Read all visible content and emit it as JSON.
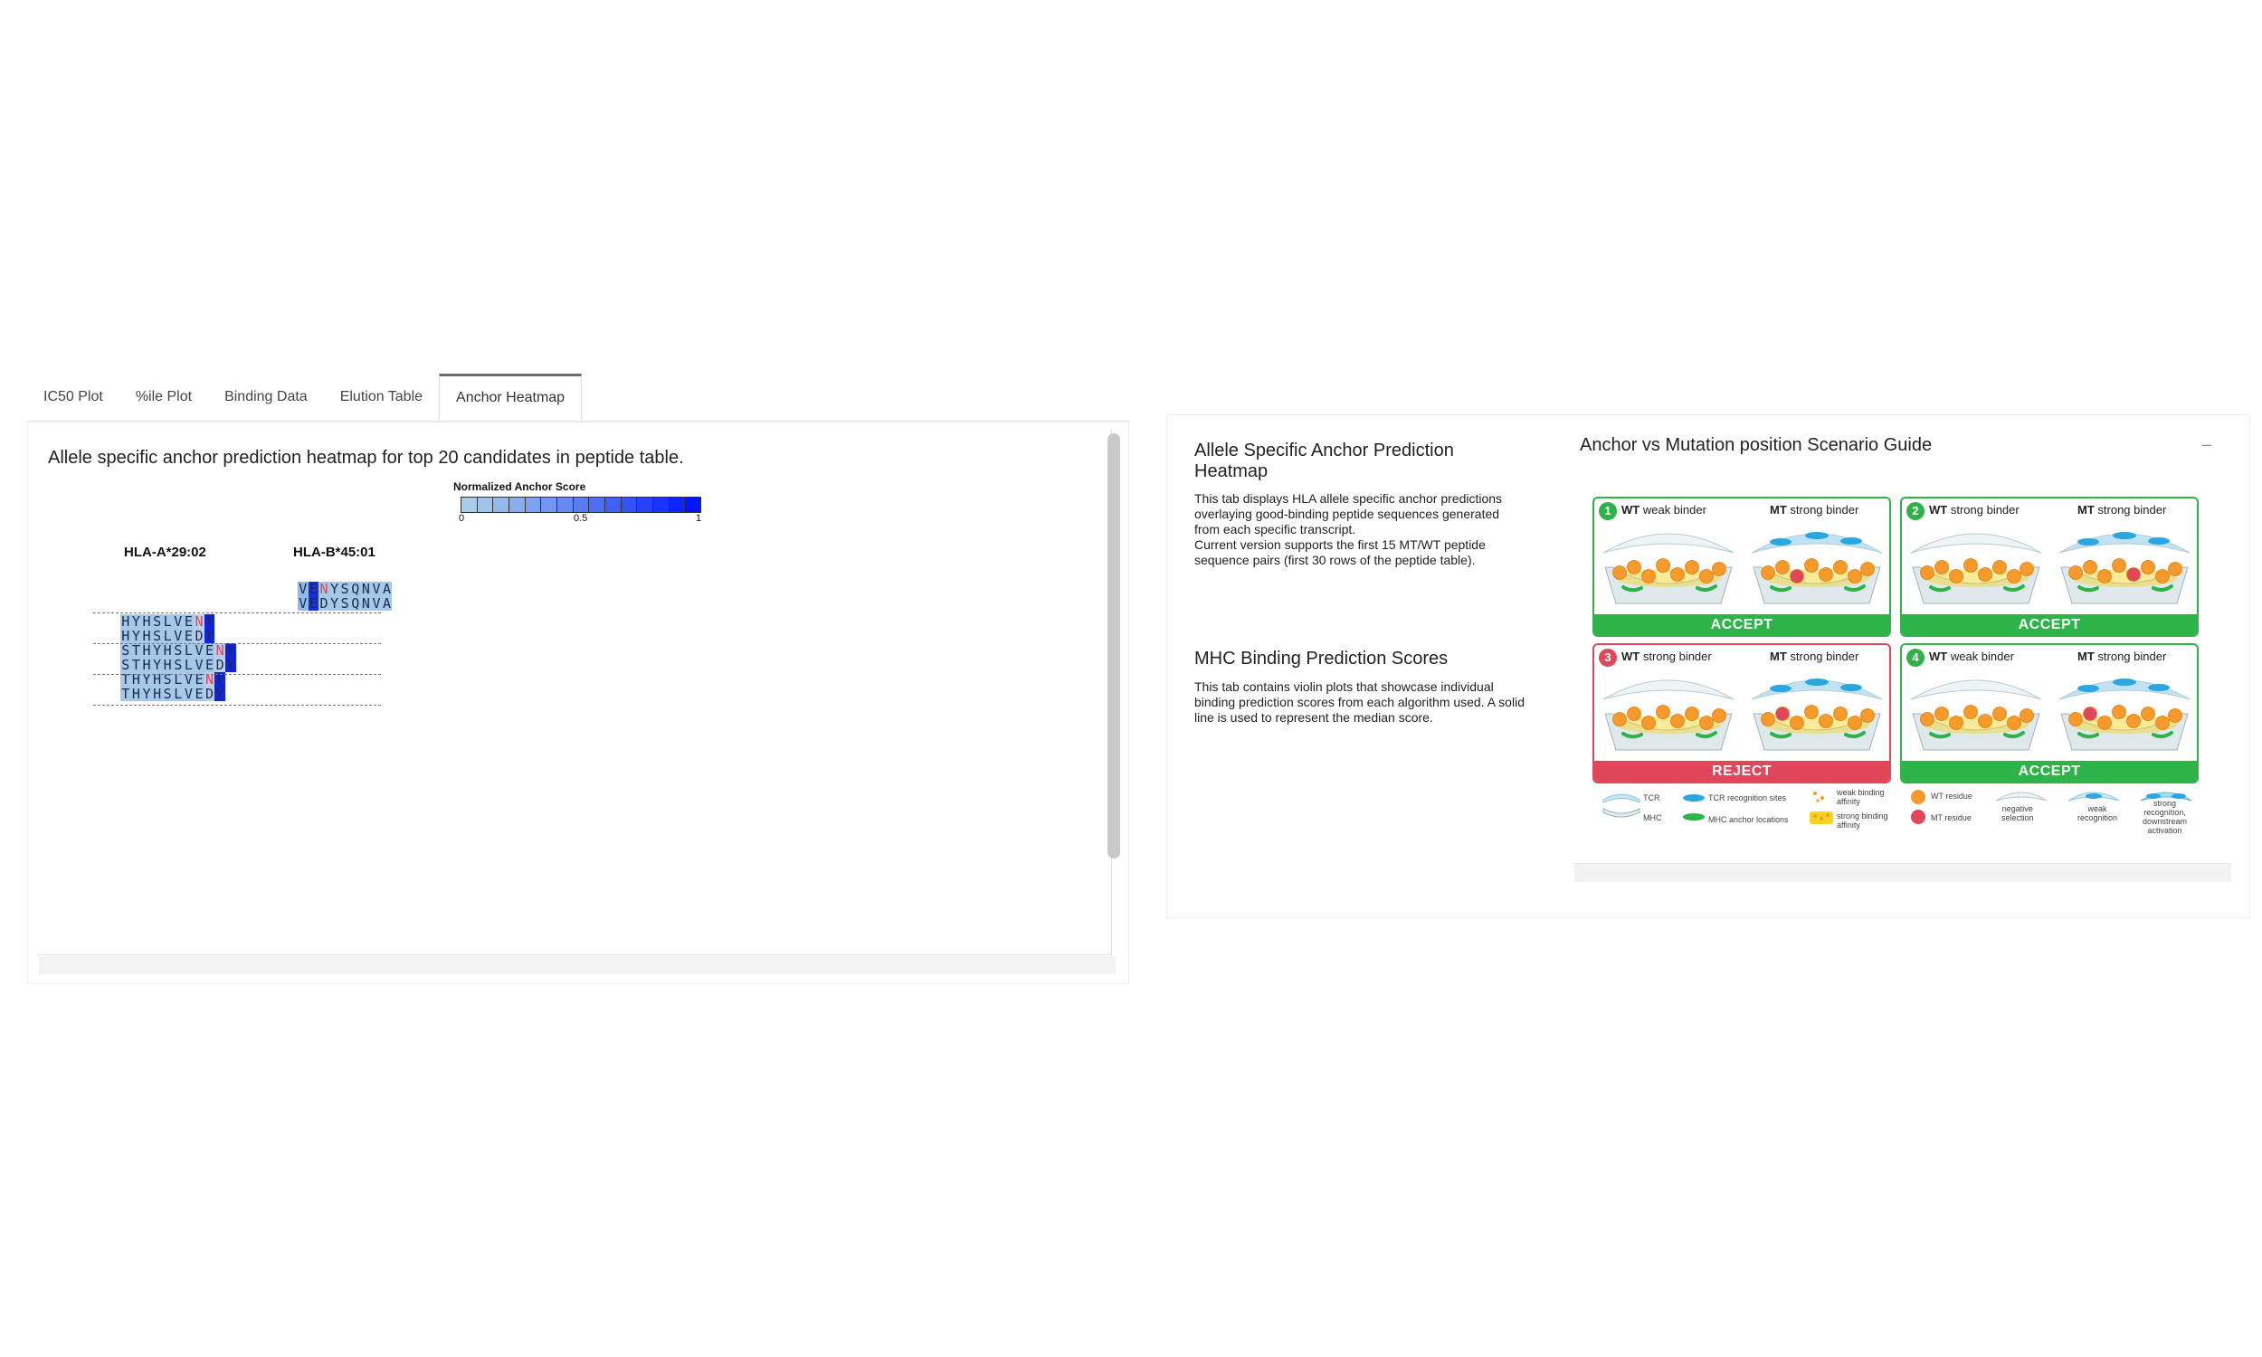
{
  "tabs": [
    "IC50 Plot",
    "%ile Plot",
    "Binding Data",
    "Elution Table",
    "Anchor Heatmap"
  ],
  "heatmap": {
    "title": "Allele specific anchor prediction heatmap for top 20 candidates in peptide table.",
    "legend_title": "Normalized Anchor Score",
    "legend_ticks": [
      "0",
      "0.5",
      "1"
    ],
    "legend_colors": [
      "#a9cde8",
      "#9fc4ea",
      "#94b9ec",
      "#89aeee",
      "#7ea2ef",
      "#7296f1",
      "#6689f2",
      "#5a7cf3",
      "#4e6ef5",
      "#4160f6",
      "#3452f8",
      "#2743f9",
      "#1a34fb",
      "#0d24fd",
      "#0014ff"
    ],
    "alleles": [
      "HLA-A*29:02",
      "HLA-B*45:01"
    ],
    "peptides_b": [
      "VENYSQNVA",
      "VEDYSQNVA"
    ],
    "peptides_a": [
      "HYHSLVENY",
      "HYHSLVEDY",
      "STHYHSLVENY",
      "STHYHSLVEDY",
      "THYHSLVENY",
      "THYHSLVEDY"
    ]
  },
  "info": {
    "heading1": "Allele Specific Anchor Prediction Heatmap",
    "para1": "This tab displays HLA allele specific anchor predictions overlaying good-binding peptide sequences generated from each specific transcript.\nCurrent version supports the first 15 MT/WT peptide sequence pairs (first 30 rows of the peptide table).",
    "heading2": "MHC Binding Prediction Scores",
    "para2": "This tab contains violin plots that showcase individual binding prediction scores from each algorithm used. A solid line is used to represent the median score."
  },
  "guide": {
    "title": "Anchor vs Mutation position Scenario Guide",
    "collapse_label": "–",
    "panels": [
      {
        "num": "1",
        "left_prefix": "WT",
        "left_text": "weak binder",
        "right_prefix": "MT",
        "right_text": "strong binder",
        "verdict": "ACCEPT"
      },
      {
        "num": "2",
        "left_prefix": "WT",
        "left_text": "strong binder",
        "right_prefix": "MT",
        "right_text": "strong binder",
        "verdict": "ACCEPT"
      },
      {
        "num": "3",
        "left_prefix": "WT",
        "left_text": "strong binder",
        "right_prefix": "MT",
        "right_text": "strong binder",
        "verdict": "REJECT"
      },
      {
        "num": "4",
        "left_prefix": "WT",
        "left_text": "weak binder",
        "right_prefix": "MT",
        "right_text": "strong binder",
        "verdict": "ACCEPT"
      }
    ],
    "key": {
      "tcr": "TCR",
      "mhc": "MHC",
      "tcr_sites": "TCR recognition sites",
      "mhc_anchor": "MHC anchor locations",
      "weak_aff": "weak binding\naffinity",
      "strong_aff": "strong binding\naffinity",
      "wt_res": "WT residue",
      "mt_res": "MT residue",
      "neg_sel": "negative\nselection",
      "weak_rec": "weak\nrecognition",
      "strong_rec": "strong\nrecognition,\ndownstream\nactivation"
    },
    "colors": {
      "accept": "#2eb349",
      "reject": "#e0475b",
      "wt_residue": "#f59a2b",
      "mt_residue": "#e0475b",
      "tcr": "#2aa7e0",
      "anchor": "#2eb349"
    }
  }
}
